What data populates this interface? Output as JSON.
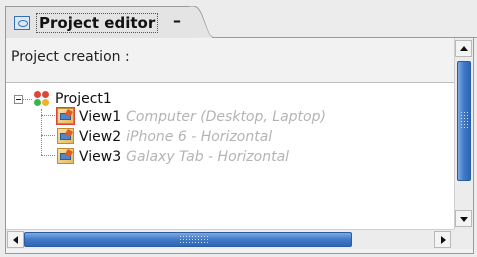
{
  "tab": {
    "label": "Project editor",
    "minimize_glyph": "–",
    "icon": "editor-view-icon"
  },
  "panel": {
    "title": "Project creation :"
  },
  "tree": {
    "root": {
      "label": "Project1",
      "icon": "project-icon",
      "expanded": true
    },
    "children": [
      {
        "label": "View1",
        "description": "Computer (Desktop, Laptop)",
        "icon": "view-icon",
        "selected": true
      },
      {
        "label": "View2",
        "description": "iPhone 6 - Horizontal",
        "icon": "view-icon"
      },
      {
        "label": "View3",
        "description": "Galaxy Tab - Horizontal",
        "icon": "view-icon"
      }
    ]
  },
  "colors": {
    "scroll_thumb": "#3f79c8",
    "description_text": "#b4b4b4"
  }
}
